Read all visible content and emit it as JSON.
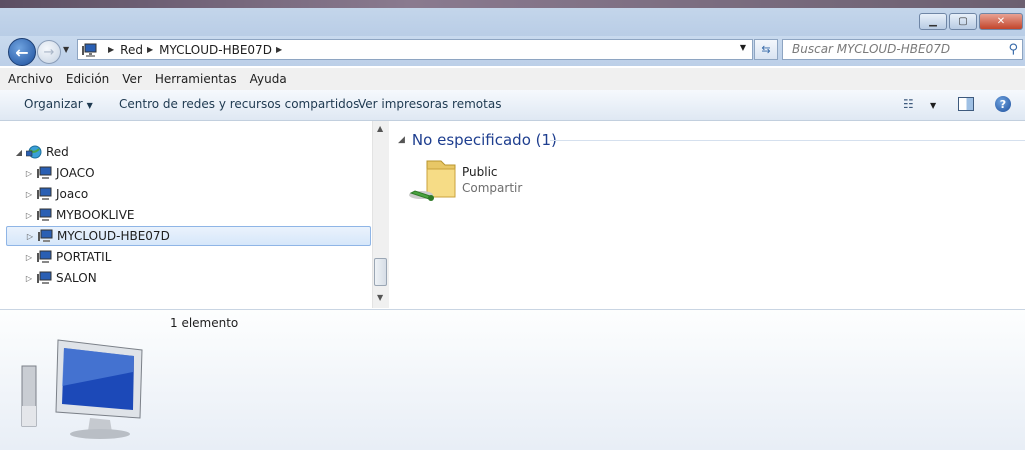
{
  "window": {
    "minimize": "▁",
    "maximize": "▢",
    "close": "✕"
  },
  "address": {
    "crumbs": [
      "Red",
      "MYCLOUD-HBE07D"
    ]
  },
  "search": {
    "placeholder": "Buscar MYCLOUD-HBE07D"
  },
  "menu": [
    "Archivo",
    "Edición",
    "Ver",
    "Herramientas",
    "Ayuda"
  ],
  "commands": {
    "organize": "Organizar",
    "network_center": "Centro de redes y recursos compartidos",
    "printers": "Ver impresoras remotas"
  },
  "tree": {
    "root": "Red",
    "items": [
      "JOACO",
      "Joaco",
      "MYBOOKLIVE",
      "MYCLOUD-HBE07D",
      "PORTATIL",
      "SALON"
    ],
    "selected": "MYCLOUD-HBE07D"
  },
  "group": {
    "title": "No especificado (1)"
  },
  "share": {
    "name": "Public",
    "type": "Compartir"
  },
  "details": {
    "count": "1 elemento"
  },
  "icons": {
    "back": "back-arrow-icon",
    "forward": "forward-arrow-icon",
    "computer": "network-computer-icon",
    "folder": "shared-folder-icon",
    "help": "help-icon"
  },
  "colors": {
    "accent": "#1e3e8f",
    "selection": "#d6e7fa"
  }
}
